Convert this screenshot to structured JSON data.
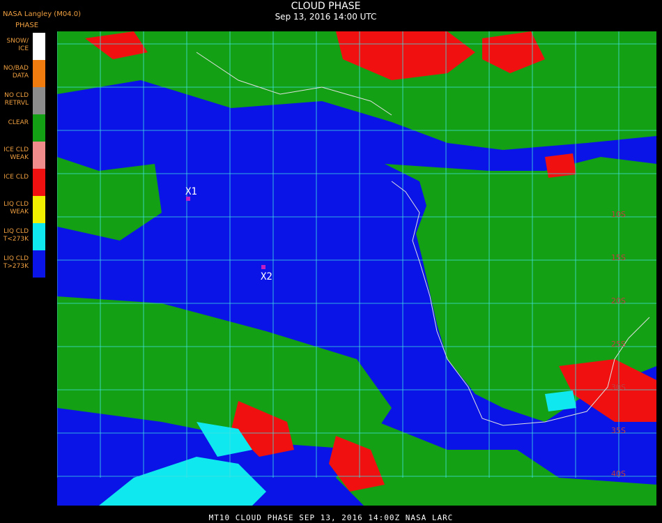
{
  "header": {
    "org": "NASA Langley (M04.0)",
    "phase_label": "PHASE",
    "title": "CLOUD PHASE",
    "subtitle": "Sep 13, 2016 14:00 UTC"
  },
  "legend": [
    {
      "label": "SNOW/\nICE",
      "color": "#ffffff"
    },
    {
      "label": "NO/BAD\nDATA",
      "color": "#f07c10"
    },
    {
      "label": "NO CLD\nRETRVL",
      "color": "#8c8c8c"
    },
    {
      "label": "CLEAR",
      "color": "#14a014"
    },
    {
      "label": "ICE CLD\nWEAK",
      "color": "#f08c8c"
    },
    {
      "label": "ICE CLD",
      "color": "#f01010"
    },
    {
      "label": "LIQ CLD\nWEAK",
      "color": "#f0f000"
    },
    {
      "label": "LIQ CLD\nT<273K",
      "color": "#10e8f0"
    },
    {
      "label": "LIQ CLD\nT>273K",
      "color": "#0a14e6"
    }
  ],
  "map": {
    "markers": [
      {
        "label": "X1",
        "color": "#c020c0"
      },
      {
        "label": "X2",
        "color": "#c020c0"
      }
    ],
    "lat_labels": [
      "10S",
      "15S",
      "20S",
      "25S",
      "30S",
      "35S",
      "40S"
    ],
    "colors": {
      "ocean": "#0a14e6",
      "land": "#14a014",
      "grid": "#40e0e0",
      "coast": "#e0e0e0",
      "lat_label": "#c04040"
    }
  },
  "footer": {
    "text": "MT10  CLOUD PHASE   SEP 13, 2016 14:00Z   NASA LARC"
  }
}
